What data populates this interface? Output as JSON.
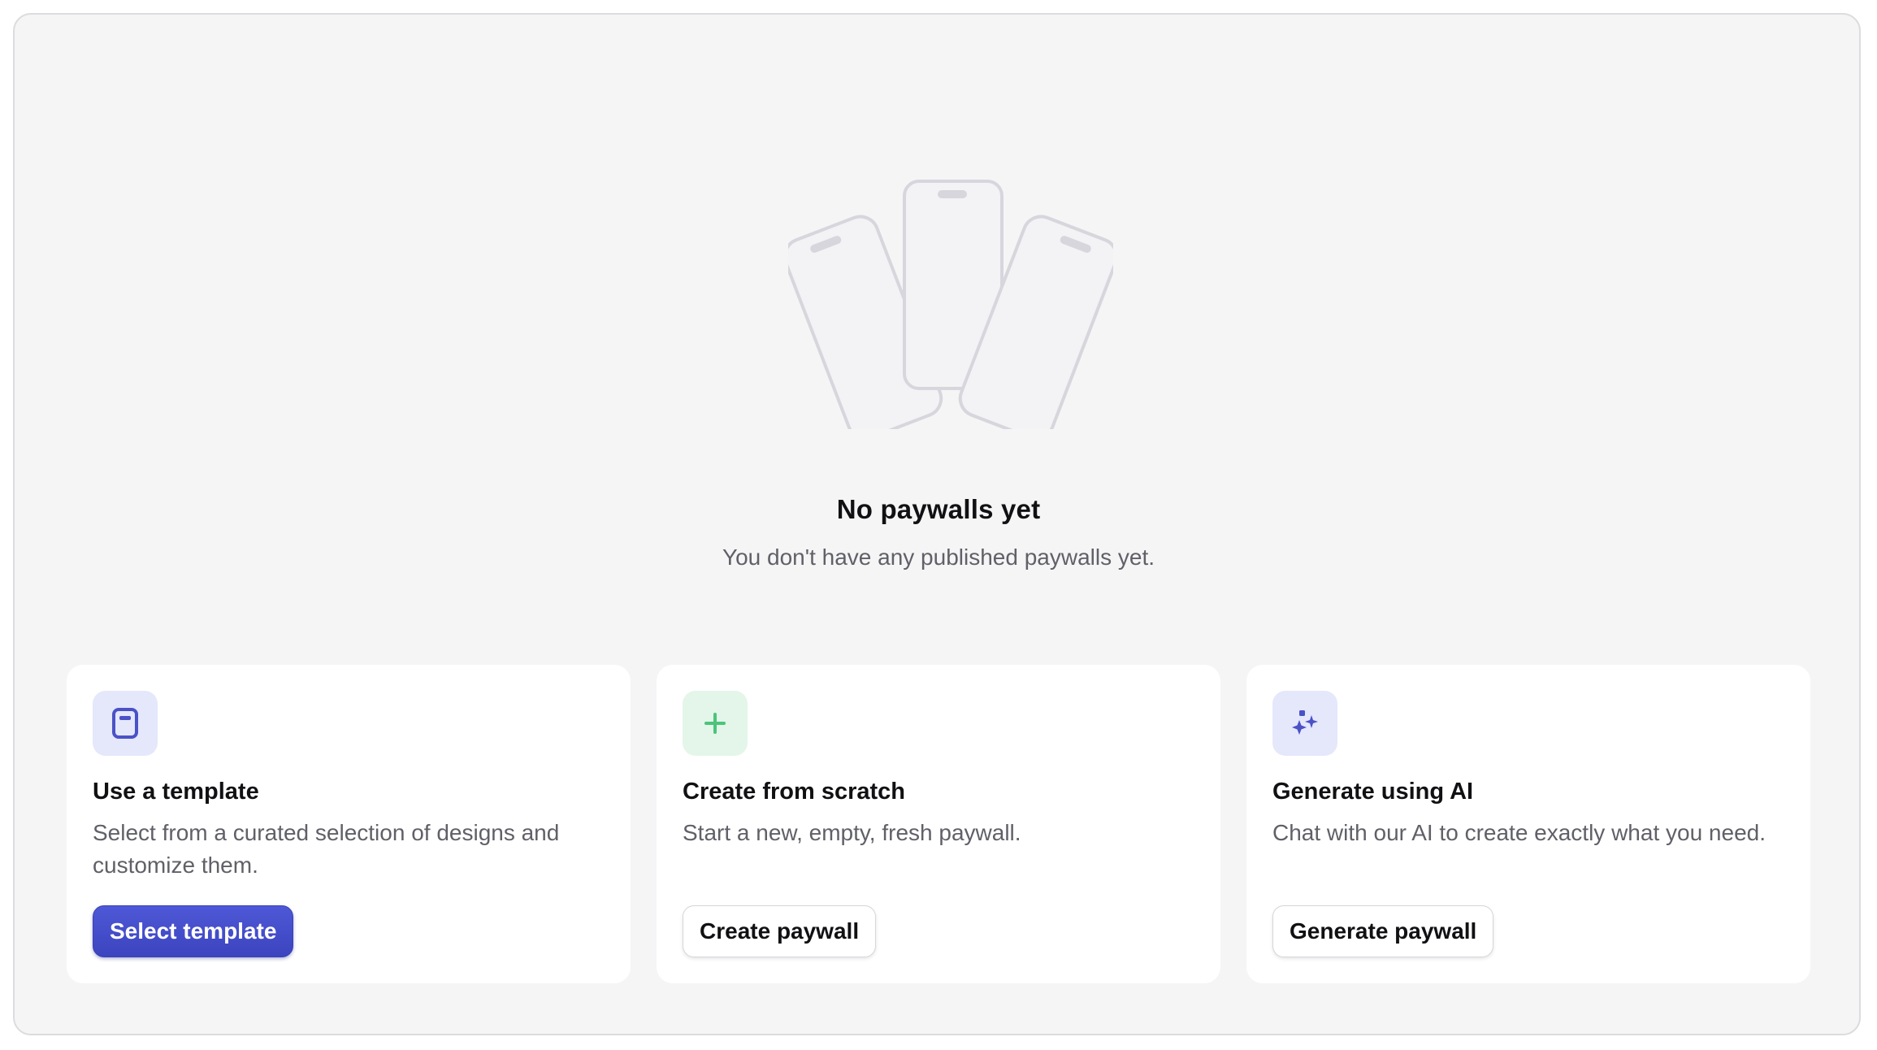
{
  "empty_state": {
    "title": "No paywalls yet",
    "subtitle": "You don't have any published paywalls yet."
  },
  "cards": [
    {
      "icon": "document-icon",
      "icon_color": "#4a52c6",
      "icon_bg": "#e5e7fb",
      "title": "Use a template",
      "description": "Select from a curated selection of designs and customize them.",
      "button_label": "Select template"
    },
    {
      "icon": "plus-icon",
      "icon_color": "#4cc47a",
      "icon_bg": "#e3f6e9",
      "title": "Create from scratch",
      "description": "Start a new, empty, fresh paywall.",
      "button_label": "Create paywall"
    },
    {
      "icon": "sparkles-icon",
      "icon_color": "#4a52c6",
      "icon_bg": "#e5e7fb",
      "title": "Generate using AI",
      "description": "Chat with our AI to create exactly what you need.",
      "button_label": "Generate paywall"
    }
  ],
  "colors": {
    "accent": "#4349c7",
    "background": "#f5f5f6"
  }
}
